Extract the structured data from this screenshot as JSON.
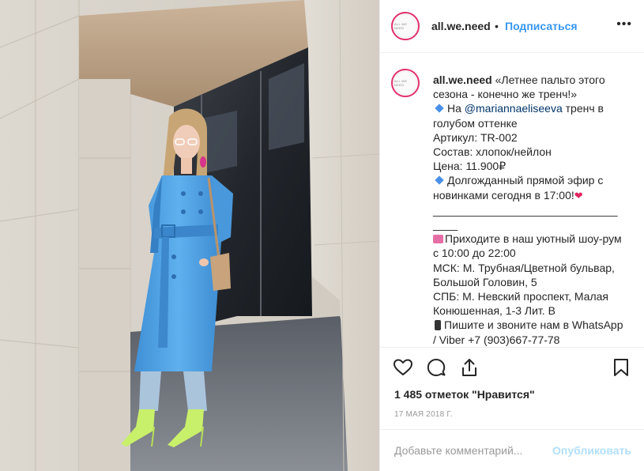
{
  "header": {
    "avatar_text": "ALL WE NEED",
    "username": "all.we.need",
    "separator": "•",
    "follow_label": "Подписаться",
    "more_label": "•••"
  },
  "caption": {
    "username": "all.we.need",
    "lines": [
      "«Летнее пальто этого",
      "сезона - конечно же тренч!»",
      "На ",
      "@mariannaeliseeva",
      " тренч в",
      "голубом оттенке",
      "Артикул: TR-002",
      "Состав: хлопок/нейлон",
      "Цена: 11.900₽",
      "Долгожданный прямой эфир с",
      "новинками сегодня в 17:00!",
      "______________________________",
      "____",
      "Приходите в наш уютный шоу-рум",
      "с 10:00 до 22:00",
      "МСК: М. Трубная/Цветной бульвар,",
      "Большой Головин, 5",
      "СПБ: М. Невский проспект, Малая",
      "Конюшенная, 1-3 Лит. В",
      "Пишите и звоните нам в WhatsApp",
      "/ Viber +7 (903)667-77-78"
    ]
  },
  "icons": {
    "like": "heart-icon",
    "comment": "comment-icon",
    "share": "share-icon",
    "save": "bookmark-icon"
  },
  "likes_text": "1 485 отметок \"Нравится\"",
  "date_text": "17 МАЯ 2018 Г.",
  "comment_input": {
    "placeholder": "Добавьте комментарий...",
    "value": ""
  },
  "publish_label": "Опубликовать",
  "colors": {
    "link": "#3897f0",
    "mention": "#003569",
    "publish_disabled": "#b2dffc"
  }
}
